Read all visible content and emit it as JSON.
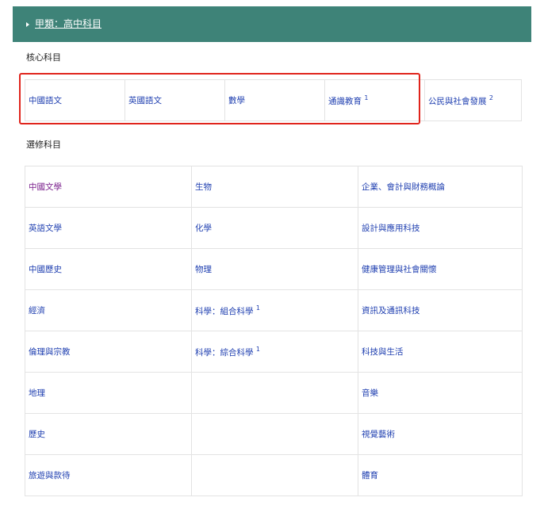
{
  "header": {
    "title": "甲類：高中科目"
  },
  "core": {
    "heading": "核心科目",
    "subjects": [
      {
        "label": "中國語文",
        "sup": ""
      },
      {
        "label": "英國語文",
        "sup": ""
      },
      {
        "label": "數學",
        "sup": ""
      },
      {
        "label": "通識教育",
        "sup": "1"
      },
      {
        "label": "公民與社會發展",
        "sup": "2"
      }
    ]
  },
  "elective": {
    "heading": "選修科目",
    "rows": [
      [
        {
          "label": "中國文學",
          "sup": ""
        },
        {
          "label": "生物",
          "sup": ""
        },
        {
          "label": "企業、會計與財務概論",
          "sup": ""
        }
      ],
      [
        {
          "label": "英語文學",
          "sup": ""
        },
        {
          "label": "化學",
          "sup": ""
        },
        {
          "label": "設計與應用科技",
          "sup": ""
        }
      ],
      [
        {
          "label": "中國歷史",
          "sup": ""
        },
        {
          "label": "物理",
          "sup": ""
        },
        {
          "label": "健康管理與社會關懷",
          "sup": ""
        }
      ],
      [
        {
          "label": "經濟",
          "sup": ""
        },
        {
          "label": "科學：組合科學",
          "sup": "1"
        },
        {
          "label": "資訊及通訊科技",
          "sup": ""
        }
      ],
      [
        {
          "label": "倫理與宗教",
          "sup": ""
        },
        {
          "label": "科學：綜合科學",
          "sup": "1"
        },
        {
          "label": "科技與生活",
          "sup": ""
        }
      ],
      [
        {
          "label": "地理",
          "sup": ""
        },
        {
          "label": "",
          "sup": ""
        },
        {
          "label": "音樂",
          "sup": ""
        }
      ],
      [
        {
          "label": "歷史",
          "sup": ""
        },
        {
          "label": "",
          "sup": ""
        },
        {
          "label": "視覺藝術",
          "sup": ""
        }
      ],
      [
        {
          "label": "旅遊與款待",
          "sup": ""
        },
        {
          "label": "",
          "sup": ""
        },
        {
          "label": "體育",
          "sup": ""
        }
      ]
    ]
  },
  "colors": {
    "header_bg": "#3e8378",
    "link": "#1f3fb0",
    "visited_link": "#7a1f8c",
    "highlight": "#e0241c"
  }
}
